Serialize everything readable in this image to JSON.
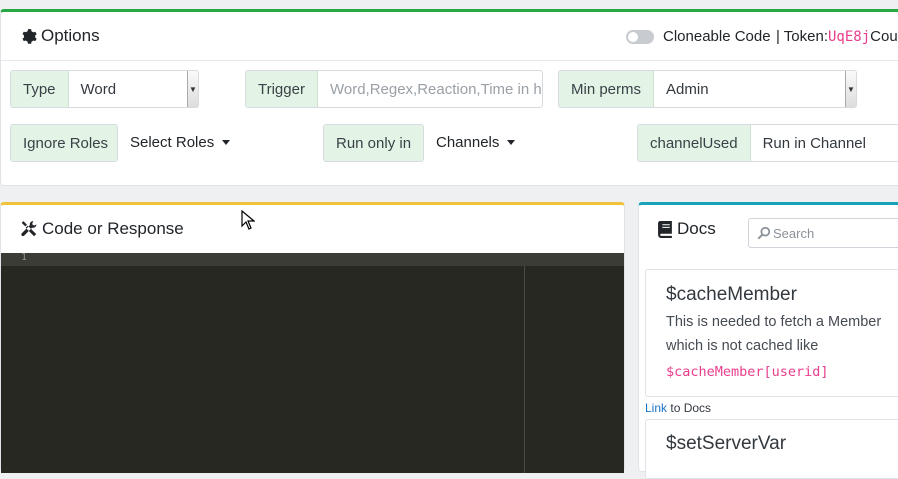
{
  "options": {
    "title": "Options",
    "cloneable_label": "Cloneable Code",
    "token_prefix": "| Token:",
    "token_value": "UqE8j",
    "token_suffix": "Cou",
    "type_label": "Type",
    "type_value": "Word",
    "trigger_label": "Trigger",
    "trigger_placeholder": "Word,Regex,Reaction,Time in h",
    "minperms_label": "Min perms",
    "minperms_value": "Admin",
    "ignore_roles_label": "Ignore Roles",
    "select_roles_label": "Select Roles",
    "run_only_label": "Run only in",
    "channels_label": "Channels",
    "channel_used_label": "channelUsed",
    "channel_used_value": "Run in Channel"
  },
  "code_panel": {
    "title": "Code or Response",
    "line_number": "1"
  },
  "docs": {
    "title": "Docs",
    "search_placeholder": "Search",
    "cards": [
      {
        "name": "$cacheMember",
        "description": "This is needed to fetch a Member which is not cached like",
        "example": "$cacheMember[userid]"
      },
      {
        "name": "$setServerVar"
      }
    ],
    "link_text": "Link",
    "link_suffix": "to Docs"
  },
  "colors": {
    "options_accent": "#28a745",
    "code_accent": "#f0c23a",
    "docs_accent": "#17a2b8",
    "editor_bg": "#272822",
    "addon_bg": "#e3f4e6",
    "token_color": "#e83e8c",
    "link_color": "#1a73c7"
  },
  "icons": {
    "options": "gear-icon",
    "code": "tools-icon",
    "docs": "book-icon",
    "search": "search-icon",
    "toggle": "toggle-switch",
    "cursor": "mouse-pointer-icon"
  }
}
